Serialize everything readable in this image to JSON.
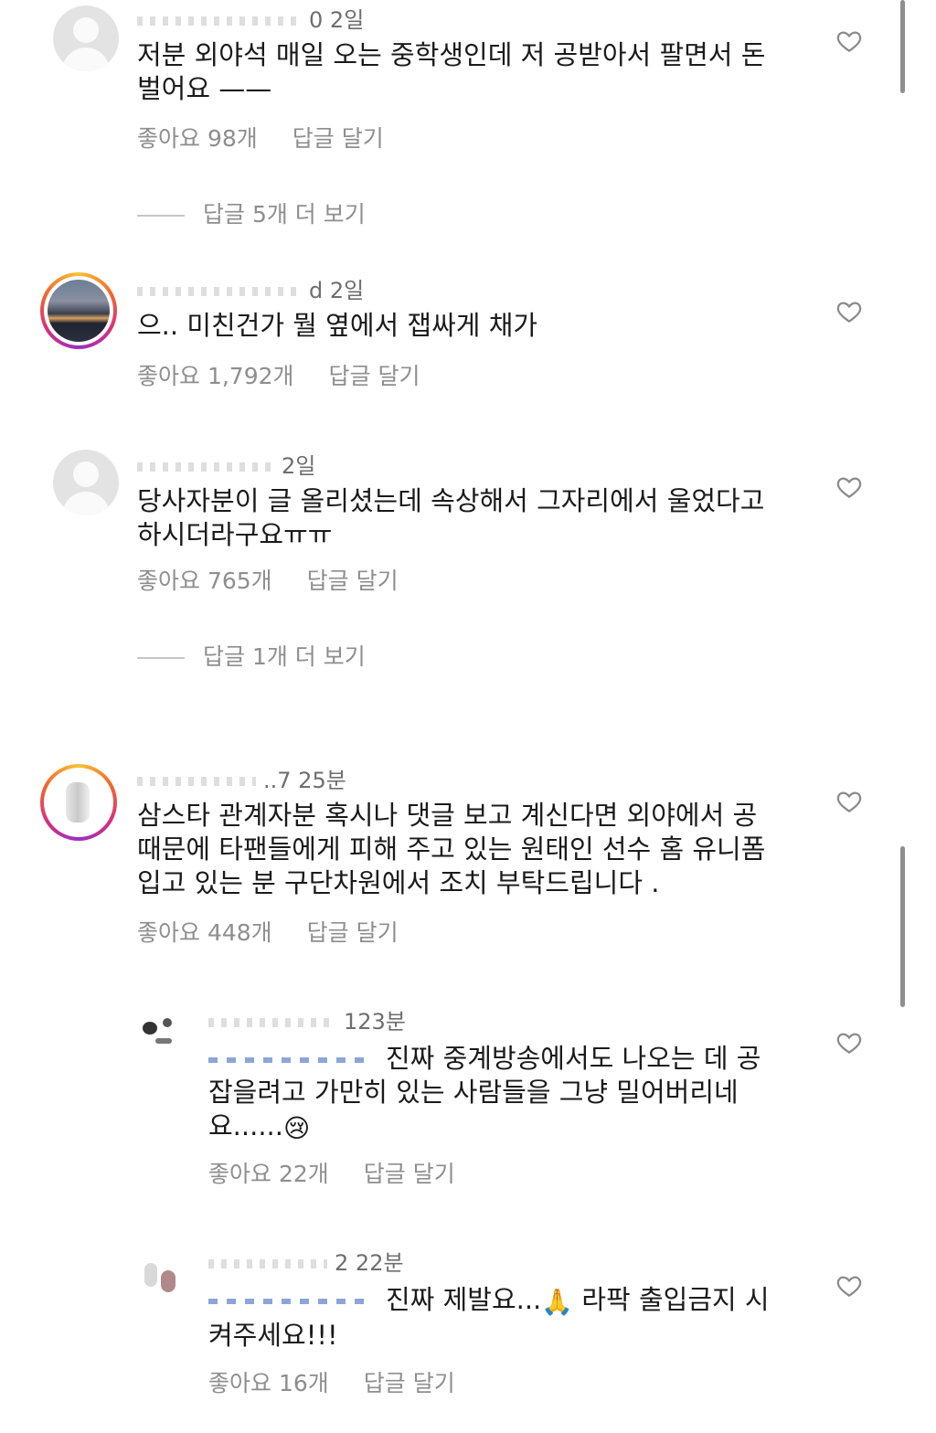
{
  "comments": [
    {
      "time": "2일",
      "username_suffix": "0",
      "text_lines": [
        "저분 외야석 매일 오는 중학생인데 저 공받아서 팔면서 돈",
        "벌어요 ——"
      ],
      "likes": "좋아요 98개",
      "reply": "답글 달기",
      "view_replies": "답글 5개 더 보기"
    },
    {
      "time": "2일",
      "username_suffix": "d",
      "text_lines": [
        "으.. 미친건가 뭘 옆에서 잽싸게 채가"
      ],
      "likes": "좋아요 1,792개",
      "reply": "답글 달기"
    },
    {
      "time": "2일",
      "username_suffix": "",
      "text_lines": [
        "당사자분이 글 올리셨는데 속상해서 그자리에서 울었다고",
        "하시더라구요ㅠㅠ"
      ],
      "likes": "좋아요 765개",
      "reply": "답글 달기",
      "view_replies": "답글 1개 더 보기"
    },
    {
      "time": "25분",
      "username_suffix": "..7",
      "text_lines": [
        "삼스타 관계자분 혹시나 댓글 보고 계신다면 외야에서 공",
        "때문에 타팬들에게 피해 주고 있는 원태인 선수 홈 유니폼",
        "입고 있는 분 구단차원에서 조치 부탁드립니다 ."
      ],
      "likes": "좋아요 448개",
      "reply": "답글 달기"
    }
  ],
  "replies": [
    {
      "time": "23분",
      "username_suffix": "1",
      "text_lines": [
        "진짜 중계방송에서도 나오는 데 공",
        "잡을려고 가만히 있는 사람들을 그냥 밀어버리네",
        "요......"
      ],
      "emoji": "😢",
      "likes": "좋아요 22개",
      "reply": "답글 달기"
    },
    {
      "time": "22분",
      "username_suffix": "2",
      "text_lines": [
        "진짜 제발요...",
        "라팍 출입금지 시",
        "켜주세요!!!"
      ],
      "emoji": "🙏",
      "likes": "좋아요 16개",
      "reply": "답글 달기"
    }
  ],
  "icons": {
    "like": "heart-outline-icon",
    "avatar_default": "default-avatar-icon"
  },
  "colors": {
    "text": "#1a1a1a",
    "muted": "#8e8e8e",
    "background": "#ffffff"
  }
}
